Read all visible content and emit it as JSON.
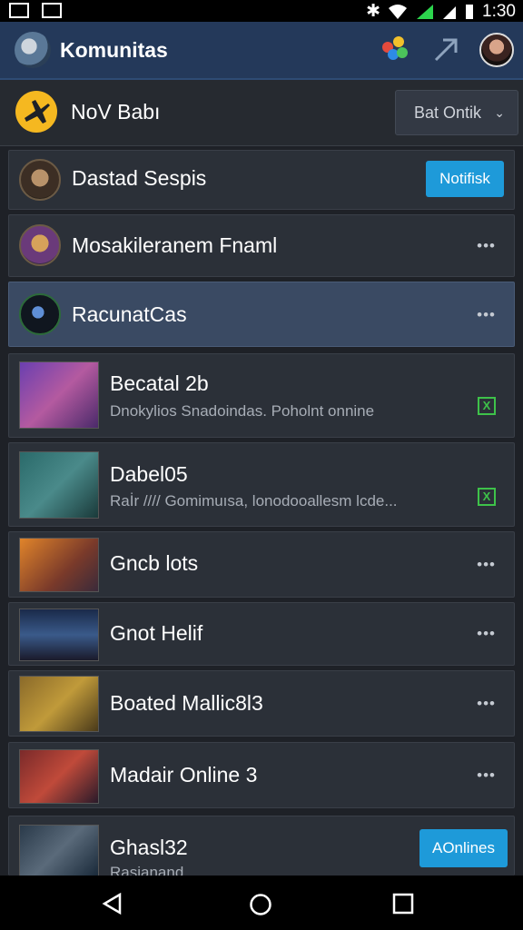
{
  "status_bar": {
    "time": "1:30"
  },
  "app_bar": {
    "title": "Komunitas"
  },
  "filter": {
    "label": "NoV Babı",
    "dropdown_label": "Bat Ontik"
  },
  "rows": [
    {
      "title": "Dastad Sespis",
      "button": "Notifisk"
    },
    {
      "title": "Mosakileranem Fnaml"
    },
    {
      "title": "RacunatCas"
    },
    {
      "title": "Becatal 2b",
      "subtitle": "Dnokylios Snadoindas. Poholnt onnine"
    },
    {
      "title": "Dabel05",
      "subtitle": "Raİr //// Gomimuısa, lonodooallesm lcde..."
    },
    {
      "title": "Gncb lots"
    },
    {
      "title": "Gnot Helif"
    },
    {
      "title": "Boated Mallic8l3"
    },
    {
      "title": "Madair Online 3"
    },
    {
      "title": "Ghasl32",
      "subtitle": "Rasjanand",
      "button": "AOnlines"
    }
  ],
  "colors": {
    "app_bar": "#24395a",
    "accent_blue": "#1e9ad9",
    "online_green": "#3ec24a",
    "background": "#1e2127"
  }
}
